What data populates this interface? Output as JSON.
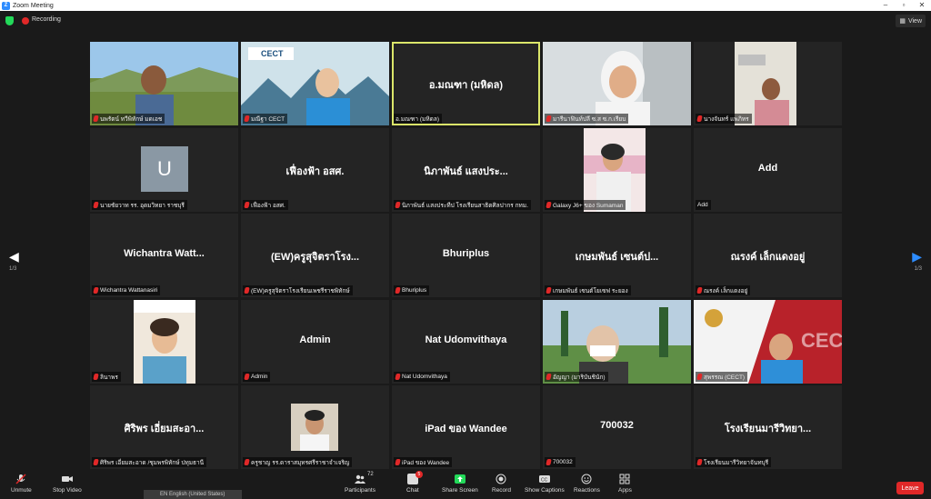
{
  "window": {
    "title": "Zoom Meeting"
  },
  "topbar": {
    "recording": "Recording",
    "view": "View"
  },
  "pagination": {
    "left": "1/3",
    "right": "1/3"
  },
  "tiles": [
    {
      "label": "นพรัตน์ ทวีพิทักษ์ มดเอช",
      "big": ""
    },
    {
      "label": "มณีฐา CECT",
      "big": ""
    },
    {
      "label": "อ.มณฑา (มหิดล)",
      "big": "อ.มณฑา (มหิดล)"
    },
    {
      "label": "มารีนาฟินท์ปลี ซ.ส ซ.ก.เรียบ",
      "big": ""
    },
    {
      "label": "นางจันทร์ แพภิทร",
      "big": ""
    },
    {
      "label": "นายชัยวาท  รร. อุดมวิทยา ราชบุรี",
      "big": "",
      "avatar": "U"
    },
    {
      "label": "เฟื่องฟ้า อสศ.",
      "big": "เฟื่องฟ้า อสศ."
    },
    {
      "label": "นิภาพันธ์  แสงประทีป  โรงเรียนสาธิตศิลปากร กทม.",
      "big": "นิภาพันธ์  แสงประ..."
    },
    {
      "label": "Galaxy J6+ ของ Sumaman",
      "big": ""
    },
    {
      "label": "Add",
      "big": "Add"
    },
    {
      "label": "Wichantra Wattanasiri",
      "big": "Wichantra  Watt..."
    },
    {
      "label": "(EW)ครูสุจิตราโรงเรียนเพชรีราชพิทักษ์",
      "big": "(EW)ครูสุจิตราโรง..."
    },
    {
      "label": "Bhuriplus",
      "big": "Bhuriplus"
    },
    {
      "label": "เกษมพันธ์ เซนต์โยเซฟ ระยอง",
      "big": "เกษมพันธ์ เซนต์ป..."
    },
    {
      "label": "ณรงค์ เล็กแดงอยู่",
      "big": "ณรงค์ เล็กแดงอยู่"
    },
    {
      "label": "ลินาพร",
      "big": ""
    },
    {
      "label": "Admin",
      "big": "Admin"
    },
    {
      "label": "Nat Udomvithaya",
      "big": "Nat Udomvithaya"
    },
    {
      "label": "อัญญา (มาริบันชินัก)",
      "big": ""
    },
    {
      "label": "สุพรรณ (CECT)",
      "big": ""
    },
    {
      "label": "ศิริพร  เอี่ยมสะอาด /ชุมพรพิทักษ์ ปทุมธานี",
      "big": "ศิริพร  เอี่ยมสะอา..."
    },
    {
      "label": "ครูชาญ รร.ดาราสมุทรศรีราชาจำเจริญ",
      "big": ""
    },
    {
      "label": "iPad ของ Wandee",
      "big": "iPad ของ Wandee"
    },
    {
      "label": "700032",
      "big": "700032"
    },
    {
      "label": "โรงเรียนมารีวิทยาจันทบุรี",
      "big": "โรงเรียนมารีวิทยา..."
    }
  ],
  "toolbar": {
    "unmute": "Unmute",
    "stop_video": "Stop Video",
    "participants": "Participants",
    "participants_count": "72",
    "chat": "Chat",
    "chat_badge": "5",
    "share_screen": "Share Screen",
    "record": "Record",
    "show_captions": "Show Captions",
    "reactions": "Reactions",
    "apps": "Apps",
    "leave": "Leave"
  },
  "language_bar": "EN English (United States)",
  "colors": {
    "accent": "#2d8cff",
    "share": "#23d959",
    "danger": "#e02828",
    "active_speaker": "#dbe66a"
  }
}
